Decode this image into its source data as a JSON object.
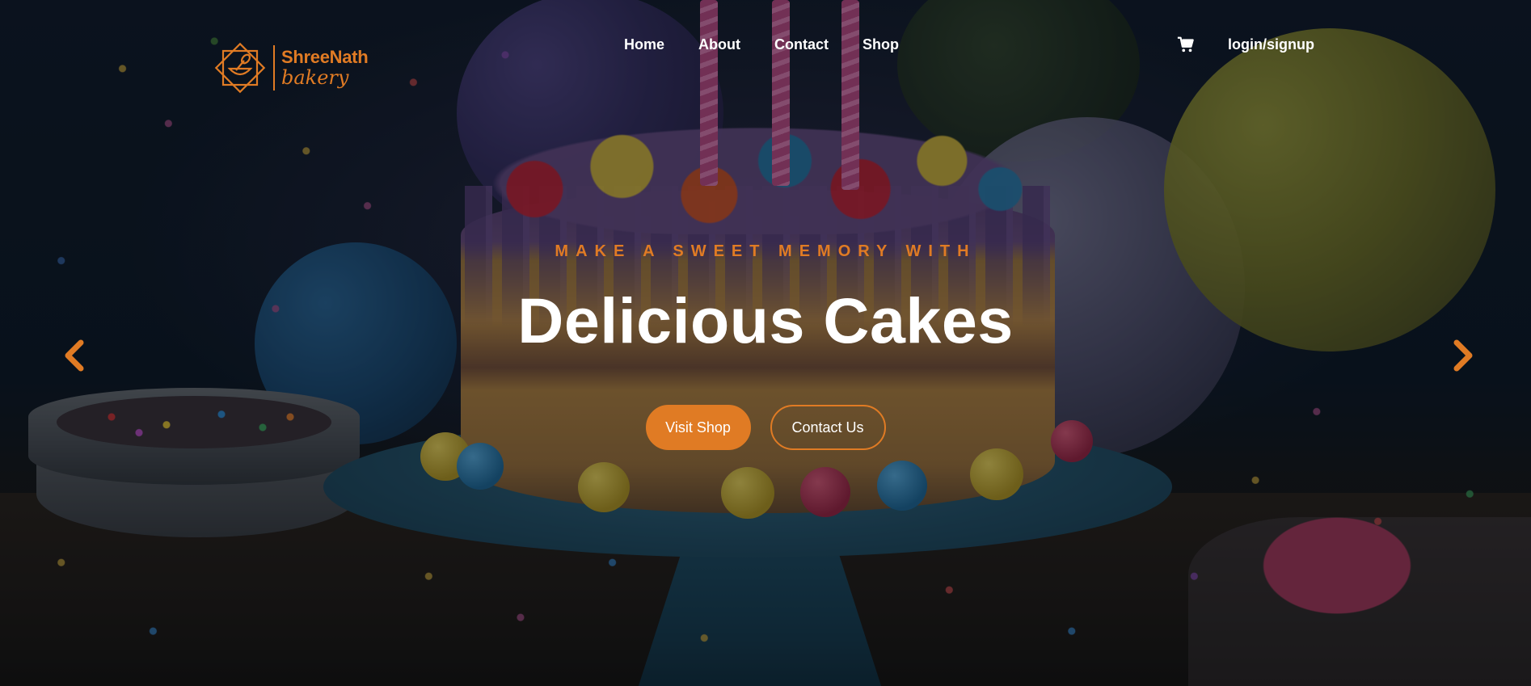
{
  "brand": {
    "name": "ShreeNath",
    "sub": "bakery",
    "accent_color": "#e07b24"
  },
  "nav": {
    "items": [
      {
        "label": "Home"
      },
      {
        "label": "About"
      },
      {
        "label": "Contact"
      },
      {
        "label": "Shop"
      }
    ],
    "cart_icon": "shopping-cart-icon",
    "auth_label": "login/signup"
  },
  "hero": {
    "eyebrow": "MAKE A SWEET MEMORY WITH",
    "title": "Delicious Cakes",
    "primary_button": "Visit Shop",
    "secondary_button": "Contact Us",
    "prev_icon": "chevron-left-icon",
    "next_icon": "chevron-right-icon"
  }
}
